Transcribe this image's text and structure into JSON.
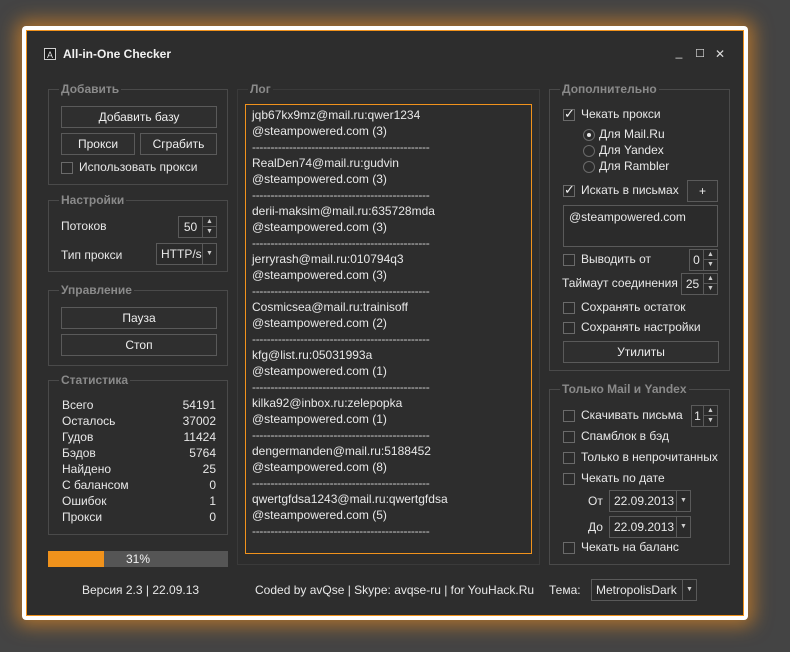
{
  "window": {
    "title": "All-in-One Checker",
    "icon_letter": "A",
    "minimize": "_",
    "maximize": "☐",
    "close": "✕"
  },
  "add": {
    "label": "Добавить",
    "add_base": "Добавить базу",
    "proxy": "Прокси",
    "grab": "Сграбить",
    "use_proxy": "Использовать прокси",
    "use_proxy_checked": false
  },
  "settings": {
    "label": "Настройки",
    "threads_label": "Потоков",
    "threads_value": "50",
    "proxy_type_label": "Тип прокси",
    "proxy_type_value": "HTTP/s"
  },
  "control": {
    "label": "Управление",
    "pause": "Пауза",
    "stop": "Стоп"
  },
  "stats": {
    "label": "Статистика",
    "rows": [
      {
        "label": "Всего",
        "value": "54191"
      },
      {
        "label": "Осталось",
        "value": "37002"
      },
      {
        "label": "Гудов",
        "value": "11424"
      },
      {
        "label": "Бэдов",
        "value": "5764"
      },
      {
        "label": "Найдено",
        "value": "25"
      },
      {
        "label": "С балансом",
        "value": "0"
      },
      {
        "label": "Ошибок",
        "value": "1"
      },
      {
        "label": "Прокси",
        "value": "0"
      }
    ]
  },
  "progress": {
    "value": 0.31,
    "text": "31%"
  },
  "log": {
    "label": "Лог",
    "separator": "------------------------------------------------",
    "entries": [
      {
        "account": "jqb67kx9mz@mail.ru:qwer1234",
        "match": "@steampowered.com (3)"
      },
      {
        "account": "RealDen74@mail.ru:gudvin",
        "match": "@steampowered.com (3)"
      },
      {
        "account": "derii-maksim@mail.ru:635728mda",
        "match": "@steampowered.com (3)"
      },
      {
        "account": "jerryrash@mail.ru:010794q3",
        "match": "@steampowered.com (3)"
      },
      {
        "account": "Cosmicsea@mail.ru:trainisoff",
        "match": "@steampowered.com (2)"
      },
      {
        "account": "kfg@list.ru:05031993a",
        "match": "@steampowered.com (1)"
      },
      {
        "account": "kilka92@inbox.ru:zelepopka",
        "match": "@steampowered.com (1)"
      },
      {
        "account": "dengermanden@mail.ru:5188452",
        "match": "@steampowered.com (8)"
      },
      {
        "account": "qwertgfdsa1243@mail.ru:qwertgfdsa",
        "match": "@steampowered.com (5)"
      }
    ]
  },
  "extra": {
    "label": "Дополнительно",
    "check_proxy": "Чекать прокси",
    "check_proxy_checked": true,
    "radio": [
      {
        "label": "Для Mail.Ru",
        "selected": true
      },
      {
        "label": "Для Yandex",
        "selected": false
      },
      {
        "label": "Для Rambler",
        "selected": false
      }
    ],
    "search_in_mail": "Искать в письмах",
    "search_in_mail_checked": true,
    "plus": "+",
    "search_text": "@steampowered.com",
    "output_from": "Выводить от",
    "output_from_value": "0",
    "timeout_label": "Таймаут соединения",
    "timeout_value": "25",
    "save_rest": "Сохранять остаток",
    "save_settings": "Сохранять настройки",
    "utilities": "Утилиты"
  },
  "mailyandex": {
    "label": "Только Mail и Yandex",
    "download": "Скачивать письма",
    "download_value": "1",
    "spamblock": "Спамблок в бэд",
    "unread_only": "Только в непрочитанных",
    "by_date": "Чекать по дате",
    "from_label": "От",
    "from_date": "22.09.2013",
    "to_label": "До",
    "to_date": "22.09.2013",
    "check_balance": "Чекать на баланс"
  },
  "footer": {
    "version": "Версия 2.3 | 22.09.13",
    "credits": "Coded by avQse | Skype: avqse-ru | for YouHack.Ru",
    "theme_label": "Тема:",
    "theme_value": "MetropolisDark"
  },
  "colors": {
    "accent": "#f0921c",
    "background": "#2d2d2d",
    "border": "#4a4a4a"
  }
}
